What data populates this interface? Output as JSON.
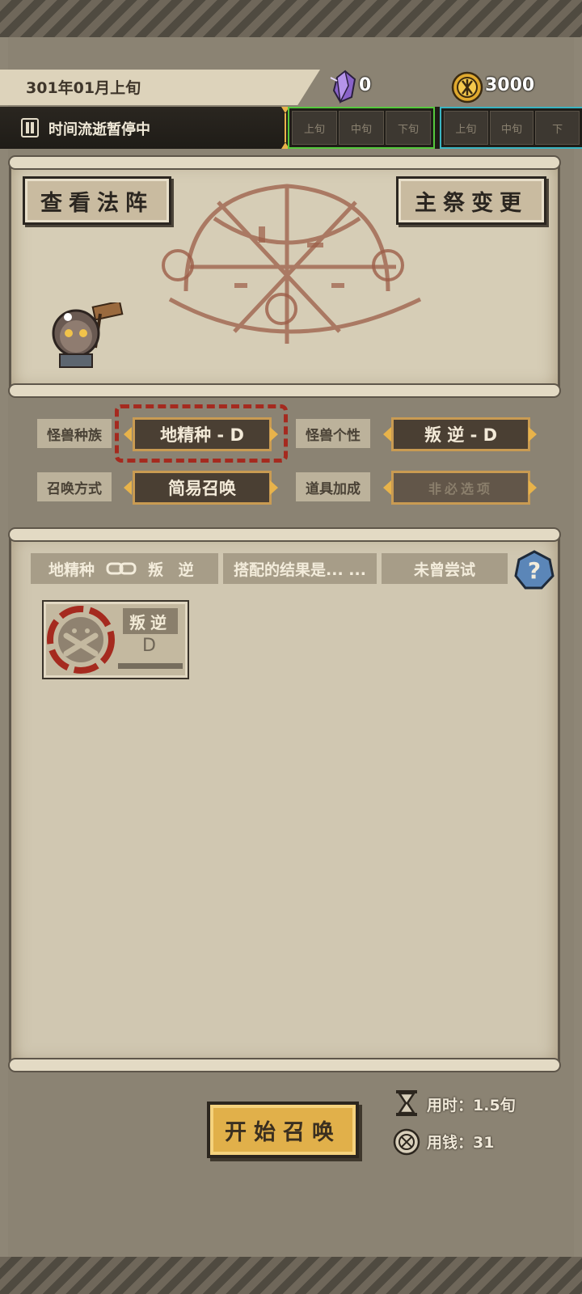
{
  "header": {
    "date": "301年01月上旬",
    "crystal_count": "0",
    "gold_count": "3000"
  },
  "time_bar": {
    "status": "时间流逝暂停中",
    "group1": [
      "上旬",
      "中旬",
      "下旬"
    ],
    "group2": [
      "上旬",
      "中旬",
      "下"
    ],
    "colors": {
      "group1": "#55c93d",
      "group2": "#3ab4c2"
    }
  },
  "ritual": {
    "view_button": "查看法阵",
    "change_button": "主祭变更"
  },
  "selectors": {
    "race_label": "怪兽种族",
    "race_value": "地精种 - D",
    "trait_label": "怪兽个性",
    "trait_value": "叛 逆 - D",
    "method_label": "召唤方式",
    "method_value": "简易召唤",
    "item_label": "道具加成",
    "item_value": "非必选项"
  },
  "combo": {
    "race": "地精种",
    "trait": "叛 逆",
    "result": "搭配的结果是... ...",
    "status": "未曾尝试"
  },
  "result_card": {
    "trait": "叛逆",
    "grade": "D"
  },
  "footer": {
    "start_button": "开始召唤",
    "time_cost": "用时：1.5旬",
    "money_cost": "用钱：31"
  }
}
